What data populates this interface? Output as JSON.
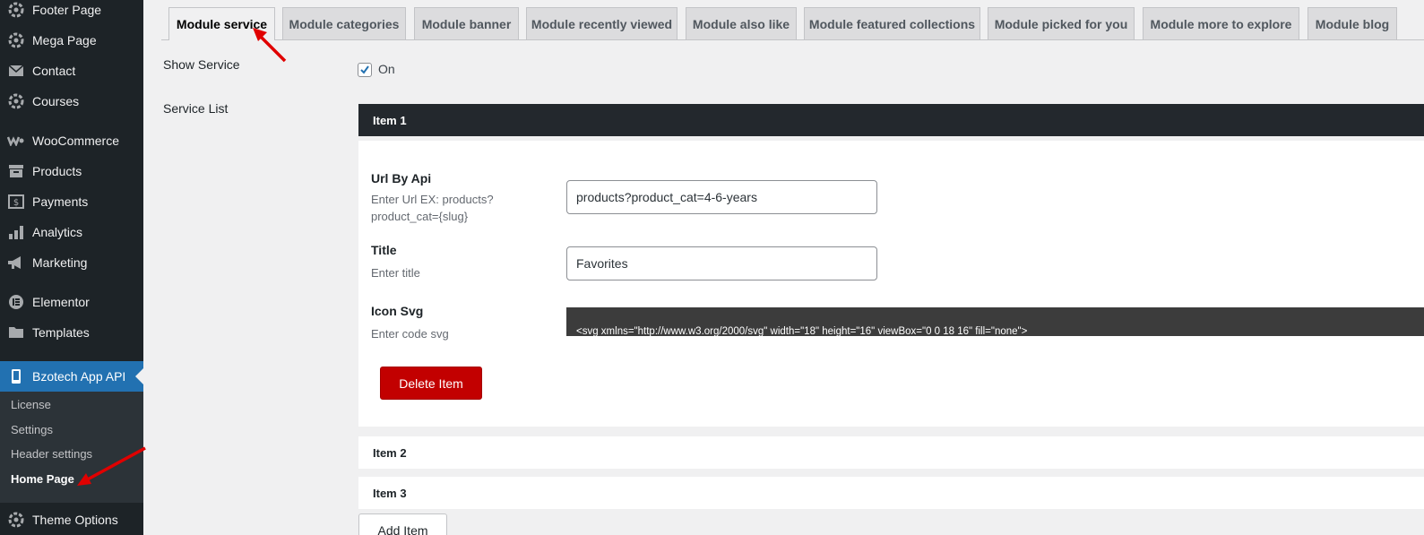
{
  "sidebar": {
    "items": [
      {
        "label": "Footer Page",
        "icon": "gear-cog-icon"
      },
      {
        "label": "Mega Page",
        "icon": "gear-cog-icon"
      },
      {
        "label": "Contact",
        "icon": "envelope-icon"
      },
      {
        "label": "Courses",
        "icon": "gear-cog-icon"
      },
      {
        "label": "WooCommerce",
        "icon": "woocommerce-icon"
      },
      {
        "label": "Products",
        "icon": "archive-icon"
      },
      {
        "label": "Payments",
        "icon": "dollar-icon"
      },
      {
        "label": "Analytics",
        "icon": "bar-chart-icon"
      },
      {
        "label": "Marketing",
        "icon": "megaphone-icon"
      },
      {
        "label": "Elementor",
        "icon": "elementor-icon"
      },
      {
        "label": "Templates",
        "icon": "folder-icon"
      },
      {
        "label": "Bzotech App API",
        "icon": "phone-icon",
        "active": true
      },
      {
        "label": "Theme Options",
        "icon": "gear-cog-icon"
      }
    ],
    "submenu": [
      "License",
      "Settings",
      "Header settings",
      "Home Page"
    ],
    "current_submenu": "Home Page"
  },
  "tabs": [
    "Module service",
    "Module categories",
    "Module banner",
    "Module recently viewed",
    "Module also like",
    "Module featured collections",
    "Module picked for you",
    "Module more to explore",
    "Module blog"
  ],
  "active_tab": "Module service",
  "form": {
    "show_service_label": "Show Service",
    "show_service_checked": true,
    "show_service_option": "On",
    "service_list_label": "Service List"
  },
  "items": [
    {
      "title": "Item 1",
      "expanded": true
    },
    {
      "title": "Item 2",
      "expanded": false
    },
    {
      "title": "Item 3",
      "expanded": false
    }
  ],
  "item1": {
    "url_label": "Url By Api",
    "url_desc_1": "Enter Url EX: products?",
    "url_desc_2": "product_cat={slug}",
    "url_value": "products?product_cat=4-6-years",
    "title_label": "Title",
    "title_desc": "Enter title",
    "title_value": "Favorites",
    "icon_label": "Icon Svg",
    "icon_desc": "Enter code svg",
    "icon_value": "<svg xmlns=\"http://www.w3.org/2000/svg\" width=\"18\" height=\"16\" viewBox=\"0 0 18 16\" fill=\"none\">",
    "delete_label": "Delete Item"
  },
  "add_item_label": "Add Item",
  "colors": {
    "sidebar_bg": "#1d2327",
    "active_menu": "#2271b1",
    "delete_button": "#c20000",
    "annotation_arrow": "#e00000"
  }
}
